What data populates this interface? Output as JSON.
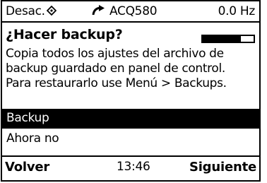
{
  "status_bar": {
    "mode_label": "Desac.",
    "mode_icon": "local-control-icon",
    "rotation_icon": "rotation-arrow-icon",
    "drive_name": "ACQ580",
    "frequency": "0.0 Hz"
  },
  "dialog": {
    "title": "¿Hacer backup?",
    "progress_fraction": 0.75,
    "message_lines": [
      "Copia todos los ajustes del archivo de",
      "backup guardado en panel de control.",
      "Para restaurarlo use Menú > Backups."
    ],
    "options": [
      {
        "label": "Backup",
        "selected": true
      },
      {
        "label": "Ahora no",
        "selected": false
      }
    ]
  },
  "softkeys": {
    "left_label": "Volver",
    "time": "13:46",
    "right_label": "Siguiente"
  }
}
